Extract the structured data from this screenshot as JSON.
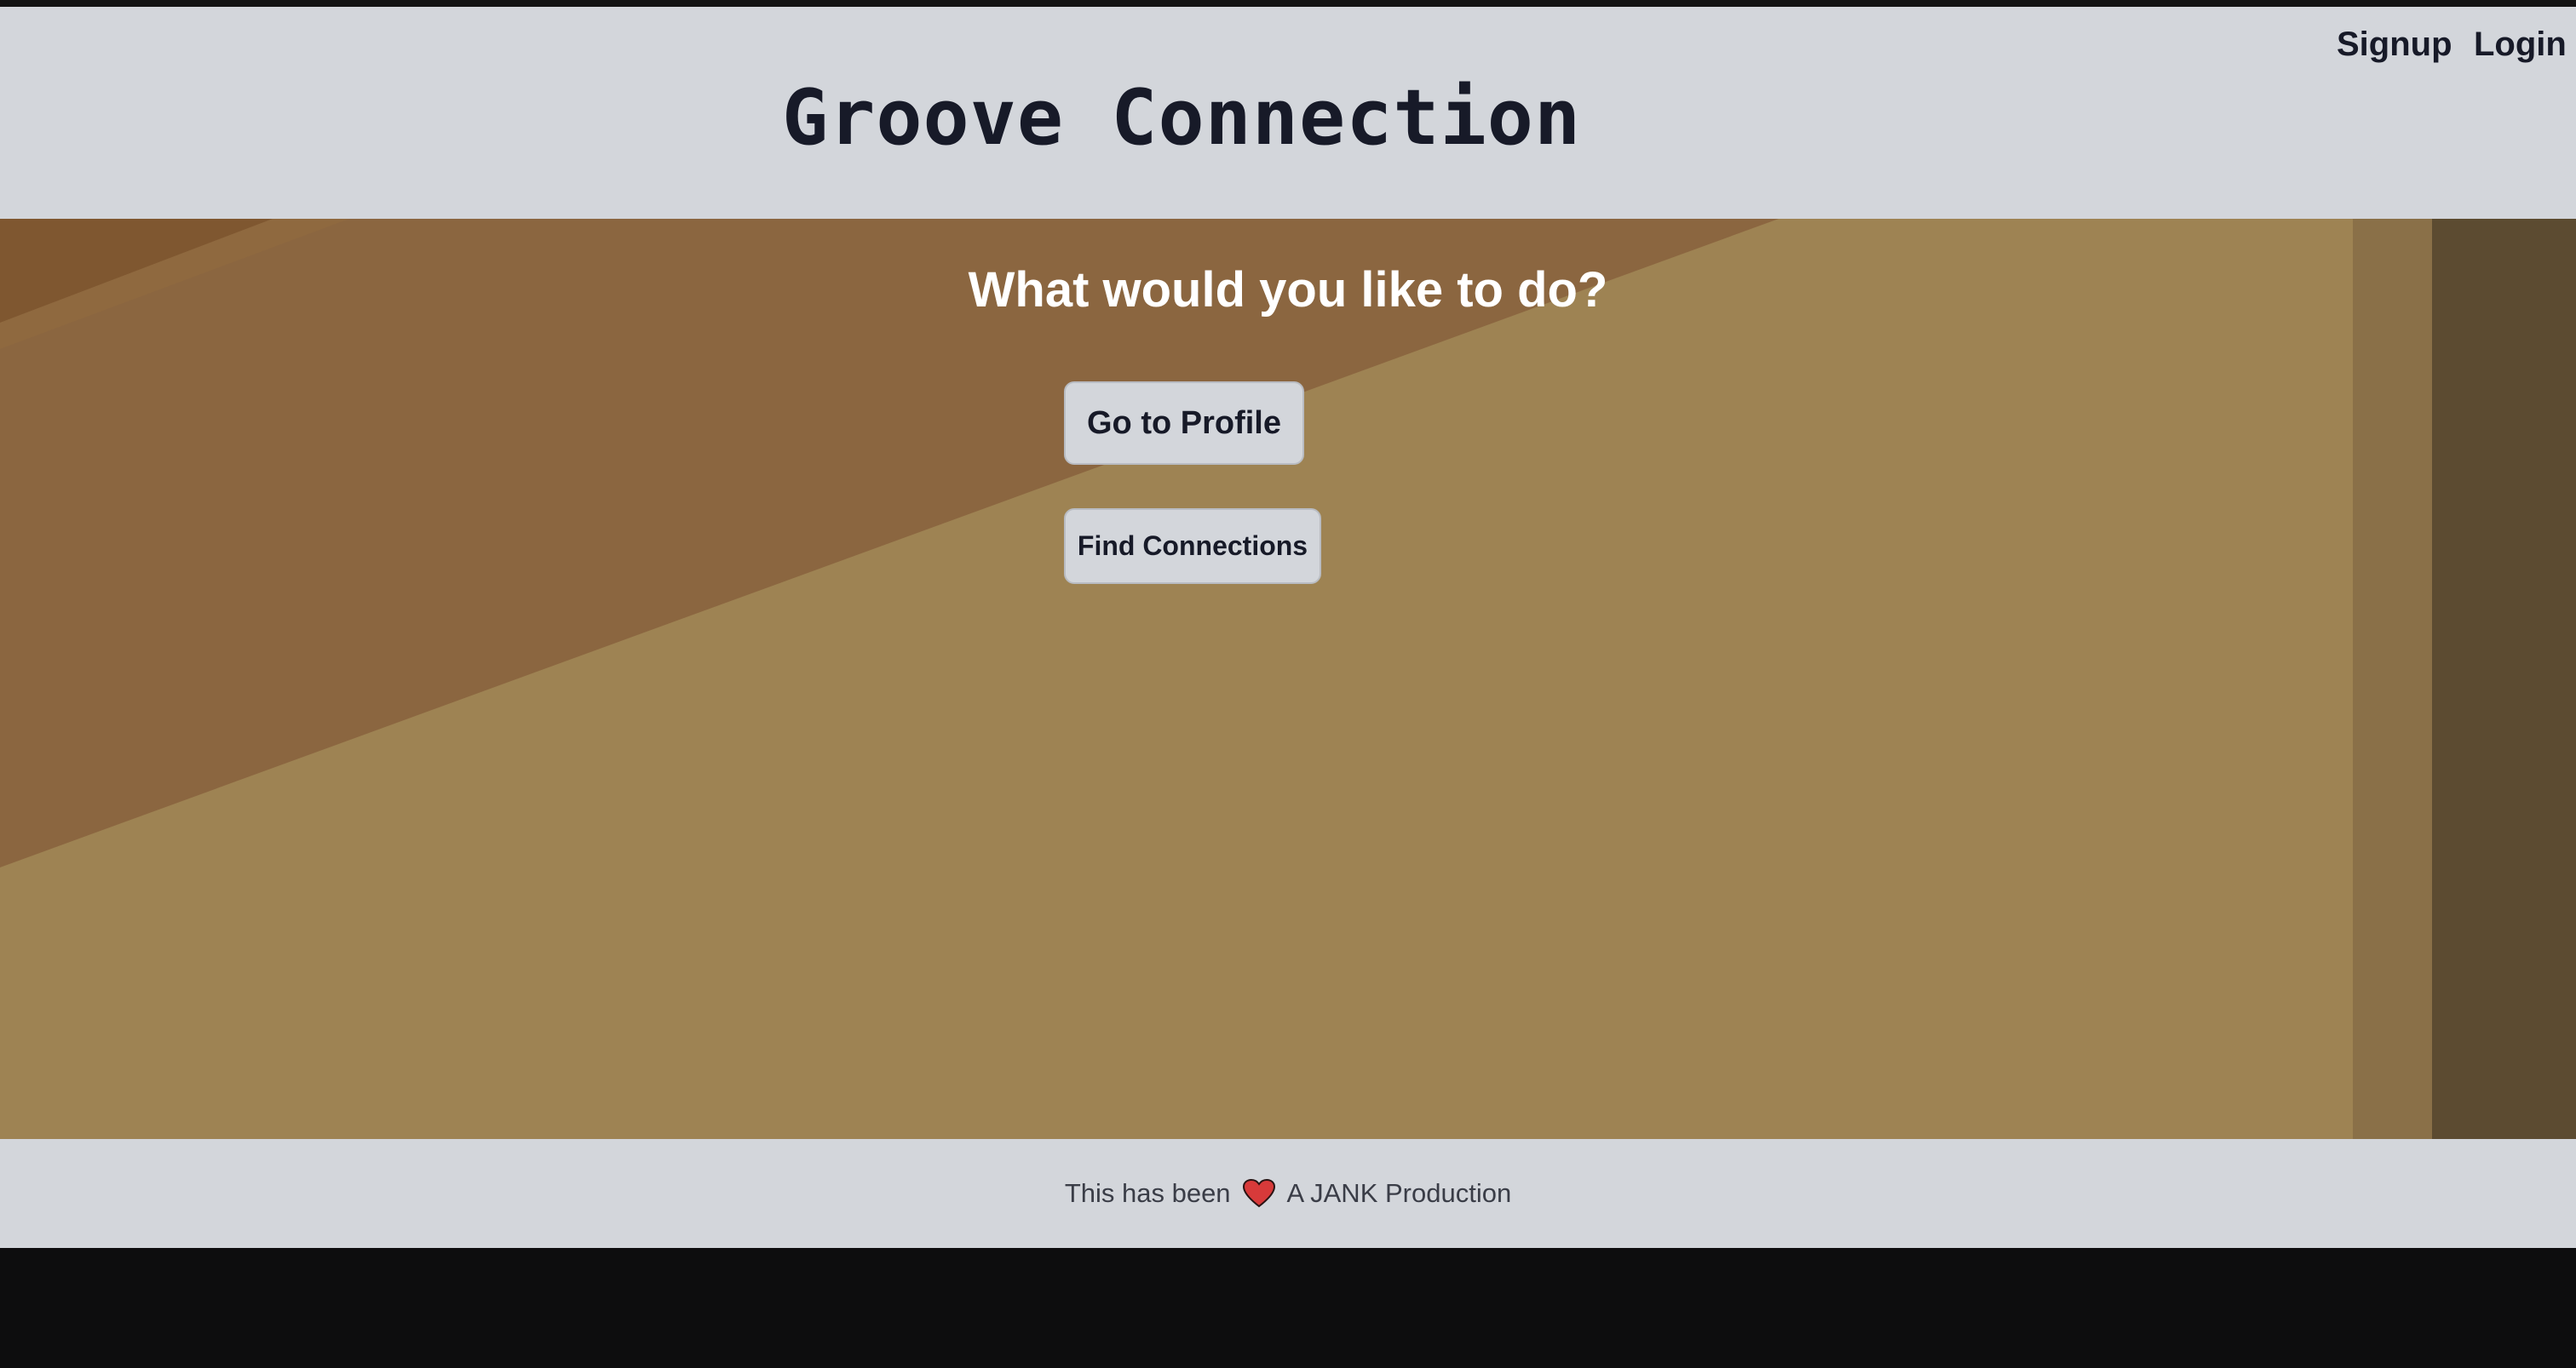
{
  "header": {
    "title": "Groove Connection",
    "nav": {
      "signup_label": "Signup",
      "login_label": "Login"
    }
  },
  "main": {
    "prompt": "What would you like to do?",
    "actions": {
      "profile_label": "Go to Profile",
      "find_label": "Find Connections"
    }
  },
  "footer": {
    "text_before": "This has been",
    "heart_icon": "heart-icon",
    "text_after": "A JANK Production"
  },
  "colors": {
    "header_bg": "#d3d6db",
    "text_dark": "#171a28",
    "hero_tan": "#9e8353",
    "hero_brown": "#8b6640",
    "heart_red": "#d83a3a"
  }
}
